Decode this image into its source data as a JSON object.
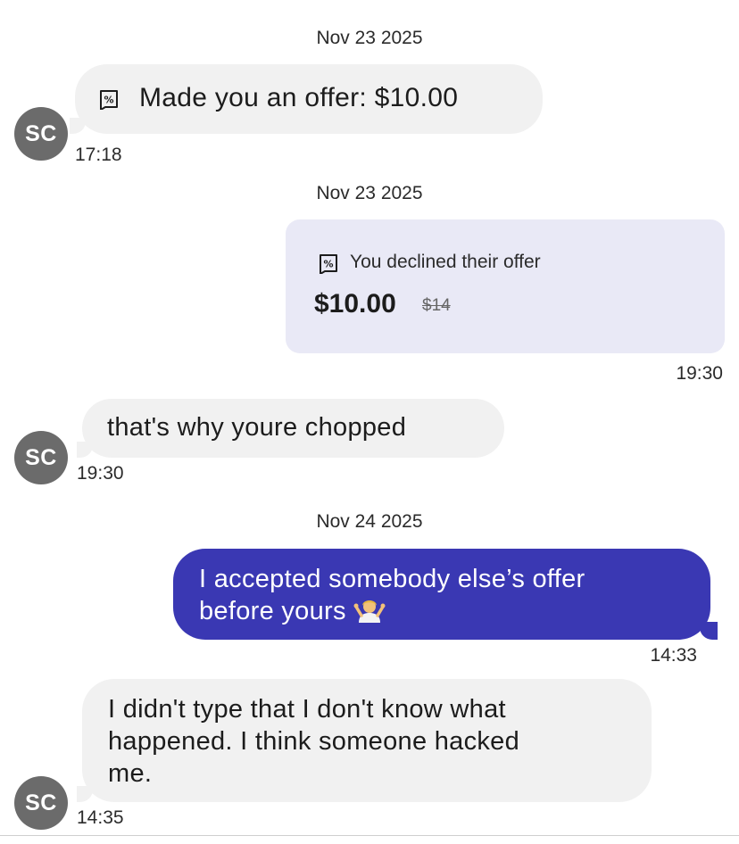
{
  "messages": [
    {
      "date": "Nov 23 2025",
      "avatar": "SC",
      "offer_text": "Made you an offer: $10.00",
      "time": "17:18"
    },
    {
      "date": "Nov 23 2025",
      "status": "You declined their offer",
      "price": "$10.00",
      "original_price": "$14",
      "time": "19:30"
    },
    {
      "avatar": "SC",
      "text": "that's why youre chopped",
      "time": "19:30"
    },
    {
      "date": "Nov 24 2025",
      "text_line1": "I accepted somebody else’s offer",
      "text_line2": "before yours",
      "emoji": "person-shrugging",
      "time": "14:33"
    },
    {
      "avatar": "SC",
      "text_line1": "I didn't type that I don't know what",
      "text_line2": "happened. I think someone hacked",
      "text_line3": "me.",
      "time": "14:35"
    }
  ],
  "colors": {
    "incoming_bubble": "#f1f1f1",
    "outgoing_bubble": "#3a38b3",
    "offer_card": "#e9e9f6",
    "avatar": "#6b6b6b"
  }
}
